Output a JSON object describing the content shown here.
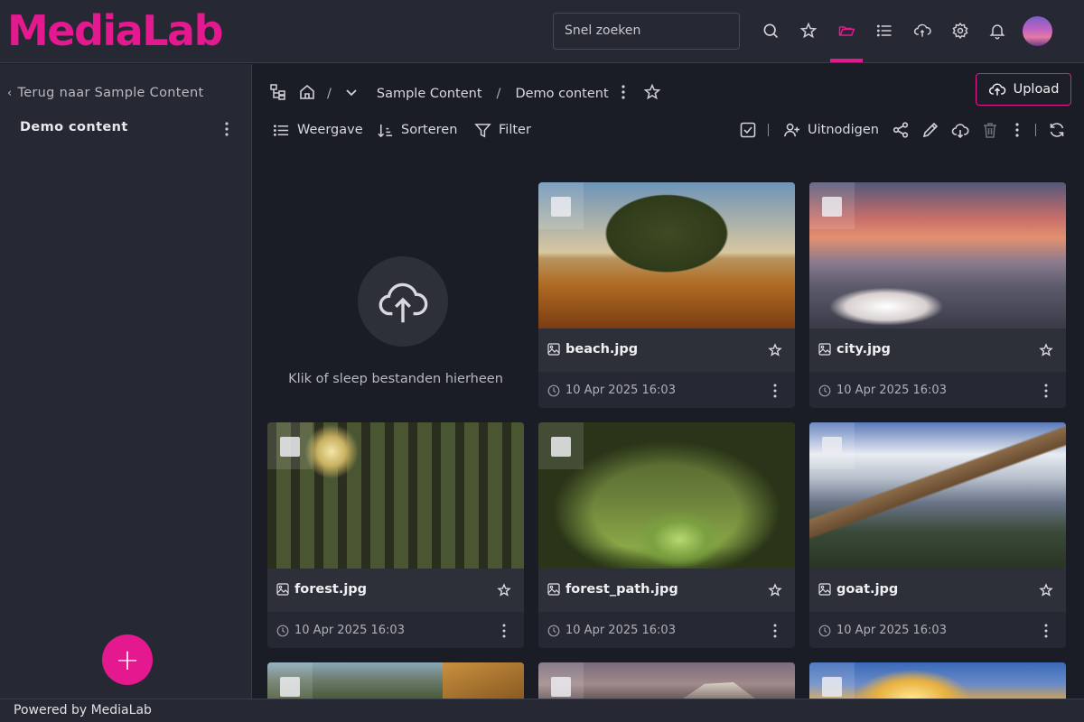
{
  "app": {
    "logo_text": "MediaLab",
    "brand_color": "#e4188f"
  },
  "header": {
    "search": {
      "placeholder": "Snel zoeken"
    },
    "icons": [
      "search-icon",
      "star-icon",
      "folder-open-icon",
      "list-icon",
      "cloud-sync-icon",
      "gear-icon",
      "bell-icon"
    ],
    "active_icon": "folder-open-icon"
  },
  "sidebar": {
    "back_label": "Terug naar Sample Content",
    "folder_title": "Demo content"
  },
  "breadcrumb": {
    "items": [
      "Sample Content",
      "Demo content"
    ],
    "separator": "/"
  },
  "toolbar": {
    "upload_label": "Upload",
    "view_label": "Weergave",
    "sort_label": "Sorteren",
    "filter_label": "Filter",
    "invite_label": "Uitnodigen"
  },
  "dropzone": {
    "text": "Klik of sleep bestanden hierheen"
  },
  "files": [
    {
      "name": "beach.jpg",
      "date": "10 Apr 2025 16:03"
    },
    {
      "name": "city.jpg",
      "date": "10 Apr 2025 16:03"
    },
    {
      "name": "forest.jpg",
      "date": "10 Apr 2025 16:03"
    },
    {
      "name": "forest_path.jpg",
      "date": "10 Apr 2025 16:03"
    },
    {
      "name": "goat.jpg",
      "date": "10 Apr 2025 16:03"
    }
  ],
  "footer": {
    "text": "Powered by MediaLab"
  }
}
